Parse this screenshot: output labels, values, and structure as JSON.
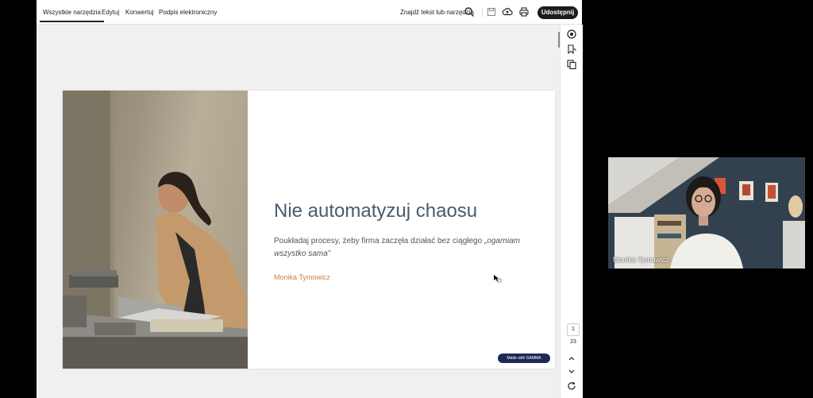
{
  "toolbar": {
    "tabs": [
      "Wszystkie narzędzia",
      "Edytuj",
      "Konwertuj",
      "Podpis elektroniczny"
    ],
    "find_label": "Znajdź tekst lub narzędzia",
    "share_label": "Udostępnij",
    "icons": [
      "search-icon",
      "save-icon",
      "upload-icon",
      "print-icon"
    ]
  },
  "rail": {
    "icons": [
      "ai-assistant-icon",
      "bookmark-icon",
      "pages-icon",
      "chevron-up-icon",
      "chevron-down-icon",
      "refresh-icon"
    ],
    "page_current": "1",
    "page_total": "23"
  },
  "slide": {
    "title": "Nie automatyzuj chaosu",
    "body_text": "Poukładaj procesy, żeby firma zaczęła działać bez ciągłego ",
    "body_quote": "„ogarniam wszystko sama”",
    "author": "Monika Tymowicz",
    "badge": "Made with GAMMA"
  },
  "video": {
    "participant_name": "Monika Tymowicz"
  },
  "colors": {
    "title": "#4a5b6d",
    "author": "#d77b3a",
    "share_button": "#1c1c1c",
    "badge": "#1d2a57"
  }
}
